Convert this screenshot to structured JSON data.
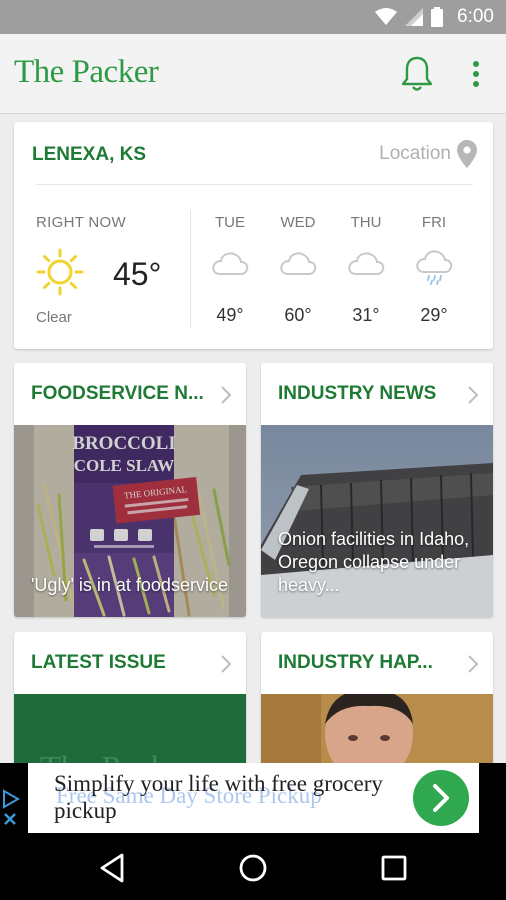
{
  "status_bar": {
    "time": "6:00"
  },
  "app_bar": {
    "title": "The Packer"
  },
  "weather": {
    "location": "LENEXA, KS",
    "location_button": "Location",
    "now_label": "RIGHT NOW",
    "now_temp": "45°",
    "now_condition": "Clear",
    "forecast": [
      {
        "day": "TUE",
        "temp": "49°",
        "icon": "cloud-icon"
      },
      {
        "day": "WED",
        "temp": "60°",
        "icon": "cloud-icon"
      },
      {
        "day": "THU",
        "temp": "31°",
        "icon": "cloud-icon"
      },
      {
        "day": "FRI",
        "temp": "29°",
        "icon": "rain-cloud-icon"
      }
    ]
  },
  "cards": {
    "foodservice": {
      "title": "FOODSERVICE N...",
      "caption": "'Ugly' is in at foodservice",
      "image_text": [
        "BROCCOLI",
        "COLE SLAW",
        "THE ORIGINAL"
      ]
    },
    "industry_news": {
      "title": "INDUSTRY NEWS",
      "caption": "Onion facilities in Idaho, Oregon collapse under heavy..."
    },
    "latest_issue": {
      "title": "LATEST ISSUE",
      "image_text": "The Packer"
    },
    "industry_happenings": {
      "title": "INDUSTRY HAP..."
    }
  },
  "ad": {
    "text": "Simplify your life with free grocery pickup",
    "ghost_text": "Free Same Day Store Pickup"
  },
  "colors": {
    "brand_green": "#2f9a45",
    "title_green": "#1e7a34",
    "ad_button": "#2fa84f"
  }
}
